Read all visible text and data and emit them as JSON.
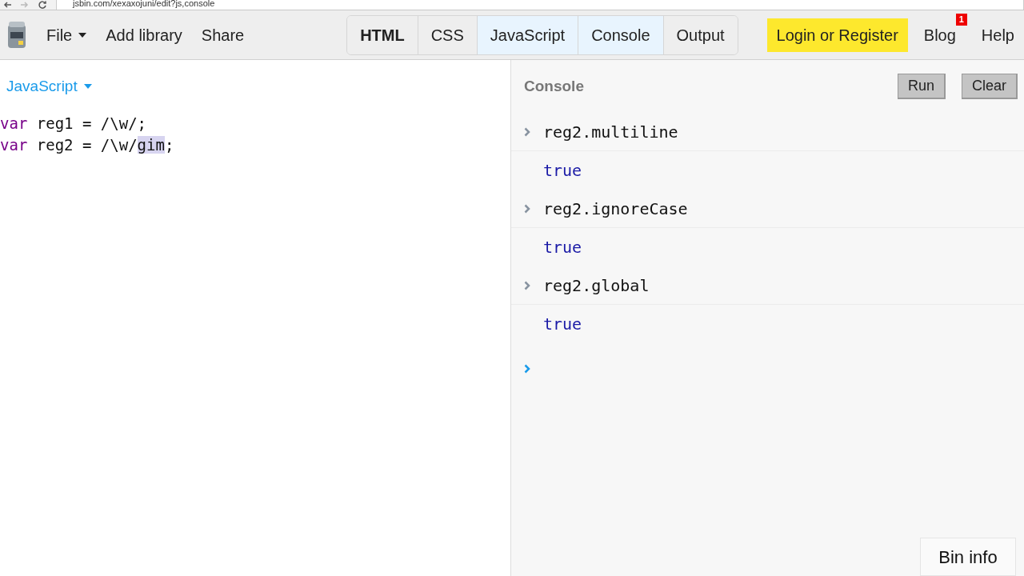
{
  "browser": {
    "url": "jsbin.com/xexaxojuni/edit?js,console"
  },
  "toolbar": {
    "menu": [
      {
        "label": "File",
        "dropdown": true
      },
      {
        "label": "Add library",
        "dropdown": false
      },
      {
        "label": "Share",
        "dropdown": false
      }
    ],
    "tabs": [
      {
        "label": "HTML",
        "selected": false,
        "bold": true
      },
      {
        "label": "CSS",
        "selected": false,
        "bold": false
      },
      {
        "label": "JavaScript",
        "selected": true,
        "bold": false
      },
      {
        "label": "Console",
        "selected": true,
        "bold": false
      },
      {
        "label": "Output",
        "selected": false,
        "bold": false
      }
    ],
    "login": "Login or Register",
    "blog": {
      "label": "Blog",
      "badge": "1"
    },
    "help": "Help"
  },
  "editor": {
    "language": "JavaScript",
    "lines": [
      [
        {
          "kind": "keyword",
          "text": "var"
        },
        {
          "kind": "plain",
          "text": " reg1 = /\\w/;"
        }
      ],
      [
        {
          "kind": "keyword",
          "text": "var"
        },
        {
          "kind": "plain",
          "text": " reg2 = /\\w/"
        },
        {
          "kind": "selection",
          "text": "gim"
        },
        {
          "kind": "plain",
          "text": ";"
        }
      ]
    ]
  },
  "console": {
    "title": "Console",
    "buttons": [
      "Run",
      "Clear"
    ],
    "entries": [
      {
        "kind": "input",
        "text": "reg2.multiline"
      },
      {
        "kind": "output",
        "text": "true"
      },
      {
        "kind": "input",
        "text": "reg2.ignoreCase"
      },
      {
        "kind": "output",
        "text": "true"
      },
      {
        "kind": "input",
        "text": "reg2.global"
      },
      {
        "kind": "output",
        "text": "true"
      }
    ]
  },
  "bin_info": "Bin info"
}
